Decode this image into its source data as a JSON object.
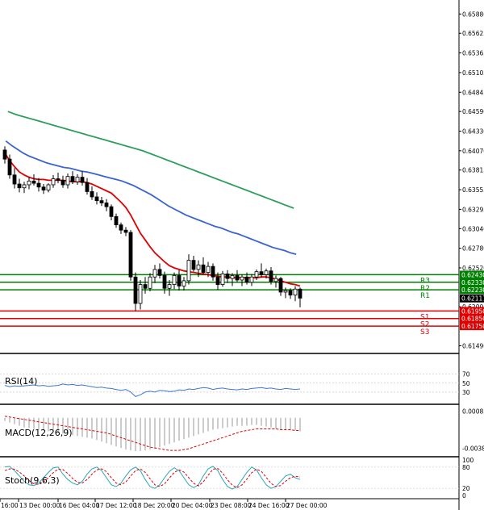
{
  "chart_data": {
    "type": "candlestick",
    "x_ticks": [
      "16:00",
      "13 Dec 00:00",
      "16 Dec 04:00",
      "17 Dec 12:00",
      "18 Dec 20:00",
      "20 Dec 04:00",
      "23 Dec 08:00",
      "24 Dec 16:00",
      "27 Dec 00:00"
    ],
    "price_axis_ticks": [
      "0.65880",
      "0.65625",
      "0.65365",
      "0.65105",
      "0.64845",
      "0.64590",
      "0.64330",
      "0.64070",
      "0.63815",
      "0.63555",
      "0.63295",
      "0.63040",
      "0.62780",
      "0.62520",
      "0.62005",
      "0.61490"
    ],
    "price_range": [
      0.6142,
      0.6598
    ],
    "levels": [
      {
        "name": "R3",
        "value": 0.6243,
        "label": "0.62430",
        "color": "#008000"
      },
      {
        "name": "R2",
        "value": 0.6233,
        "label": "0.62330",
        "color": "#008000"
      },
      {
        "name": "R1",
        "value": 0.6223,
        "label": "0.62230",
        "color": "#008000"
      },
      {
        "name": "S1",
        "value": 0.6195,
        "label": "0.61950",
        "color": "#e00000"
      },
      {
        "name": "S2",
        "value": 0.6185,
        "label": "0.61850",
        "color": "#e00000"
      },
      {
        "name": "S3",
        "value": 0.6175,
        "label": "0.61750",
        "color": "#e00000"
      }
    ],
    "last_price": {
      "value": 0.62117,
      "label": "0.62117"
    },
    "candles": [
      [
        0.6408,
        0.6413,
        0.639,
        0.6396
      ],
      [
        0.6396,
        0.6402,
        0.637,
        0.6375
      ],
      [
        0.6375,
        0.6384,
        0.6357,
        0.6363
      ],
      [
        0.6363,
        0.637,
        0.6352,
        0.6358
      ],
      [
        0.6358,
        0.6366,
        0.6351,
        0.6362
      ],
      [
        0.6362,
        0.6372,
        0.6356,
        0.6367
      ],
      [
        0.6367,
        0.6376,
        0.6361,
        0.6364
      ],
      [
        0.6364,
        0.6371,
        0.6353,
        0.6359
      ],
      [
        0.6359,
        0.6363,
        0.635,
        0.6355
      ],
      [
        0.6355,
        0.6364,
        0.6352,
        0.6362
      ],
      [
        0.6362,
        0.6375,
        0.6358,
        0.637
      ],
      [
        0.637,
        0.6378,
        0.6364,
        0.6368
      ],
      [
        0.6368,
        0.6374,
        0.6358,
        0.6362
      ],
      [
        0.6362,
        0.6377,
        0.6357,
        0.6373
      ],
      [
        0.6373,
        0.638,
        0.6363,
        0.6366
      ],
      [
        0.6366,
        0.6376,
        0.6362,
        0.6372
      ],
      [
        0.6372,
        0.638,
        0.6361,
        0.6365
      ],
      [
        0.6365,
        0.6371,
        0.6349,
        0.6353
      ],
      [
        0.6353,
        0.636,
        0.6342,
        0.6346
      ],
      [
        0.6346,
        0.6352,
        0.6336,
        0.6341
      ],
      [
        0.6341,
        0.6346,
        0.6334,
        0.6338
      ],
      [
        0.6338,
        0.6343,
        0.6327,
        0.6333
      ],
      [
        0.6333,
        0.6336,
        0.6315,
        0.632
      ],
      [
        0.632,
        0.6324,
        0.6305,
        0.6309
      ],
      [
        0.6309,
        0.6312,
        0.6297,
        0.6302
      ],
      [
        0.6302,
        0.6306,
        0.6294,
        0.6299
      ],
      [
        0.6299,
        0.6302,
        0.6235,
        0.624
      ],
      [
        0.624,
        0.6246,
        0.6195,
        0.6205
      ],
      [
        0.6205,
        0.6236,
        0.6197,
        0.623
      ],
      [
        0.623,
        0.624,
        0.6218,
        0.6225
      ],
      [
        0.6225,
        0.6245,
        0.6221,
        0.624
      ],
      [
        0.624,
        0.6256,
        0.6232,
        0.625
      ],
      [
        0.625,
        0.6258,
        0.6238,
        0.6242
      ],
      [
        0.6242,
        0.6247,
        0.6218,
        0.6225
      ],
      [
        0.6225,
        0.6236,
        0.6215,
        0.623
      ],
      [
        0.623,
        0.6246,
        0.6224,
        0.6242
      ],
      [
        0.6242,
        0.6249,
        0.6222,
        0.6228
      ],
      [
        0.6228,
        0.624,
        0.6222,
        0.6235
      ],
      [
        0.6235,
        0.627,
        0.623,
        0.6262
      ],
      [
        0.6262,
        0.6268,
        0.6247,
        0.625
      ],
      [
        0.625,
        0.6262,
        0.624,
        0.6256
      ],
      [
        0.6256,
        0.6266,
        0.6243,
        0.6246
      ],
      [
        0.6246,
        0.626,
        0.624,
        0.6254
      ],
      [
        0.6254,
        0.6258,
        0.6235,
        0.624
      ],
      [
        0.624,
        0.6246,
        0.6223,
        0.623
      ],
      [
        0.623,
        0.6248,
        0.6227,
        0.6244
      ],
      [
        0.6244,
        0.6249,
        0.6232,
        0.6238
      ],
      [
        0.6238,
        0.6245,
        0.6228,
        0.6242
      ],
      [
        0.6242,
        0.6249,
        0.6233,
        0.6236
      ],
      [
        0.6236,
        0.6243,
        0.6228,
        0.624
      ],
      [
        0.624,
        0.6246,
        0.623,
        0.6233
      ],
      [
        0.6233,
        0.6244,
        0.6228,
        0.624
      ],
      [
        0.624,
        0.625,
        0.6236,
        0.6247
      ],
      [
        0.6247,
        0.6258,
        0.6239,
        0.6243
      ],
      [
        0.6243,
        0.6251,
        0.6238,
        0.6248
      ],
      [
        0.6248,
        0.6253,
        0.623,
        0.6234
      ],
      [
        0.6234,
        0.6242,
        0.6226,
        0.6238
      ],
      [
        0.6238,
        0.624,
        0.6215,
        0.622
      ],
      [
        0.622,
        0.6226,
        0.6212,
        0.6222
      ],
      [
        0.6222,
        0.6225,
        0.6211,
        0.6216
      ],
      [
        0.6216,
        0.6228,
        0.6208,
        0.6224
      ],
      [
        0.6224,
        0.6226,
        0.62,
        0.6212
      ]
    ],
    "ma_lines": [
      {
        "color": "#e00000",
        "values": [
          0.6404,
          0.6394,
          0.6386,
          0.6379,
          0.6375,
          0.6372,
          0.637,
          0.6369,
          0.6369,
          0.6368,
          0.6368,
          0.6368,
          0.6368,
          0.6367,
          0.6366,
          0.6366,
          0.6366,
          0.6365,
          0.6363,
          0.636,
          0.6357,
          0.6354,
          0.6351,
          0.6345,
          0.6339,
          0.6332,
          0.6322,
          0.631,
          0.6298,
          0.6289,
          0.628,
          0.6272,
          0.6266,
          0.626,
          0.6255,
          0.6252,
          0.625,
          0.6248,
          0.6247,
          0.6246,
          0.6245,
          0.6244,
          0.6243,
          0.6242,
          0.6241,
          0.624,
          0.624,
          0.6239,
          0.6239,
          0.6239,
          0.6239,
          0.6239,
          0.6239,
          0.624,
          0.624,
          0.6239,
          0.6237,
          0.6235,
          0.6233,
          0.6231,
          0.623,
          0.6228
        ]
      },
      {
        "color": "#3a63d4",
        "values": [
          0.642,
          0.6414,
          0.6409,
          0.6404,
          0.64,
          0.6397,
          0.6394,
          0.6391,
          0.6389,
          0.6387,
          0.6385,
          0.6384,
          0.6382,
          0.638,
          0.6379,
          0.6377,
          0.6375,
          0.6373,
          0.6371,
          0.6369,
          0.6367,
          0.6364,
          0.6361,
          0.6357,
          0.6353,
          0.6349,
          0.6344,
          0.6339,
          0.6334,
          0.633,
          0.6326,
          0.6322,
          0.6319,
          0.6316,
          0.6313,
          0.631,
          0.6307,
          0.6305,
          0.6302,
          0.6299,
          0.6297,
          0.6294,
          0.6291,
          0.6288,
          0.6285,
          0.6282,
          0.6279,
          0.6277,
          0.6275,
          0.6272,
          0.627
        ]
      },
      {
        "color": "#2e9e5c",
        "values": [
          0.6459,
          0.6455,
          0.6452,
          0.6449,
          0.6446,
          0.6443,
          0.644,
          0.6437,
          0.6434,
          0.6431,
          0.6428,
          0.6425,
          0.6422,
          0.6419,
          0.6416,
          0.6413,
          0.641,
          0.6407,
          0.6403,
          0.6399,
          0.6395,
          0.6391,
          0.6387,
          0.6383,
          0.6379,
          0.6375,
          0.6371,
          0.6367,
          0.6363,
          0.6359,
          0.6355,
          0.6351,
          0.6347,
          0.6343,
          0.6339,
          0.6335,
          0.6331
        ]
      }
    ],
    "rsi": {
      "label": "RSI(14)",
      "ticks": [
        "70",
        "50",
        "30"
      ],
      "range": [
        10,
        100
      ],
      "values": [
        45,
        42,
        44,
        43,
        44,
        45,
        46,
        44,
        45,
        43,
        44,
        45,
        48,
        46,
        47,
        45,
        46,
        44,
        42,
        40,
        41,
        39,
        38,
        36,
        34,
        36,
        30,
        20,
        24,
        30,
        32,
        30,
        34,
        33,
        31,
        32,
        35,
        34,
        37,
        36,
        38,
        40,
        39,
        36,
        38,
        39,
        37,
        36,
        35,
        37,
        36,
        38,
        39,
        40,
        38,
        39,
        37,
        36,
        38,
        37,
        36,
        37
      ]
    },
    "macd": {
      "label": "MACD(12,26,9)",
      "ticks": [
        "0.000831",
        "-0.003826"
      ],
      "range": [
        -0.0045,
        0.0013
      ],
      "histogram": [
        -0.0004,
        -0.0006,
        -0.0008,
        -0.001,
        -0.0012,
        -0.0013,
        -0.0014,
        -0.0015,
        -0.0016,
        -0.0017,
        -0.0018,
        -0.0019,
        -0.002,
        -0.0021,
        -0.0022,
        -0.0023,
        -0.0024,
        -0.0025,
        -0.0026,
        -0.0028,
        -0.003,
        -0.0032,
        -0.0034,
        -0.0036,
        -0.0038,
        -0.004,
        -0.0041,
        -0.0042,
        -0.0042,
        -0.0041,
        -0.004,
        -0.0039,
        -0.0037,
        -0.0035,
        -0.0033,
        -0.0031,
        -0.0029,
        -0.0027,
        -0.0025,
        -0.0023,
        -0.0021,
        -0.0019,
        -0.0017,
        -0.0015,
        -0.0014,
        -0.0013,
        -0.0012,
        -0.0011,
        -0.001,
        -0.001,
        -0.001,
        -0.0009,
        -0.0009,
        -0.001,
        -0.0011,
        -0.0012,
        -0.0014,
        -0.0015,
        -0.0015,
        -0.0016,
        -0.0016,
        -0.0017
      ],
      "signal": [
        0.0002,
        0.0001,
        0.0,
        -0.0001,
        -0.0002,
        -0.0003,
        -0.0004,
        -0.0005,
        -0.0006,
        -0.0007,
        -0.0008,
        -0.0009,
        -0.001,
        -0.0011,
        -0.0012,
        -0.0013,
        -0.0014,
        -0.0015,
        -0.0016,
        -0.0017,
        -0.0018,
        -0.0019,
        -0.0021,
        -0.0023,
        -0.0025,
        -0.0027,
        -0.0029,
        -0.0031,
        -0.0033,
        -0.0035,
        -0.0037,
        -0.0038,
        -0.0039,
        -0.004,
        -0.0041,
        -0.0041,
        -0.0041,
        -0.004,
        -0.0039,
        -0.0037,
        -0.0035,
        -0.0033,
        -0.0031,
        -0.0029,
        -0.0027,
        -0.0025,
        -0.0023,
        -0.0021,
        -0.0019,
        -0.0017,
        -0.0016,
        -0.0015,
        -0.0014,
        -0.0014,
        -0.0014,
        -0.0014,
        -0.0014,
        -0.0015,
        -0.0015,
        -0.0015,
        -0.0016,
        -0.0016
      ]
    },
    "stoch": {
      "label": "Stoch(9,6,3)",
      "ticks": [
        "100",
        "80",
        "20",
        "0"
      ],
      "main": [
        80,
        82,
        70,
        55,
        40,
        30,
        28,
        35,
        50,
        65,
        78,
        80,
        60,
        45,
        35,
        30,
        40,
        60,
        75,
        80,
        70,
        50,
        30,
        25,
        35,
        55,
        72,
        80,
        70,
        45,
        25,
        20,
        30,
        50,
        68,
        78,
        70,
        50,
        30,
        22,
        30,
        55,
        75,
        82,
        70,
        45,
        25,
        18,
        25,
        45,
        65,
        80,
        72,
        50,
        30,
        20,
        25,
        40,
        55,
        60,
        50,
        45
      ],
      "signal": [
        70,
        75,
        74,
        66,
        55,
        42,
        33,
        31,
        38,
        50,
        64,
        74,
        73,
        62,
        48,
        37,
        35,
        45,
        60,
        72,
        75,
        67,
        50,
        35,
        30,
        38,
        55,
        70,
        75,
        65,
        47,
        30,
        25,
        33,
        49,
        65,
        72,
        66,
        50,
        34,
        27,
        38,
        57,
        74,
        76,
        63,
        44,
        29,
        22,
        30,
        46,
        64,
        74,
        68,
        51,
        34,
        25,
        28,
        40,
        50,
        54,
        52
      ]
    }
  }
}
